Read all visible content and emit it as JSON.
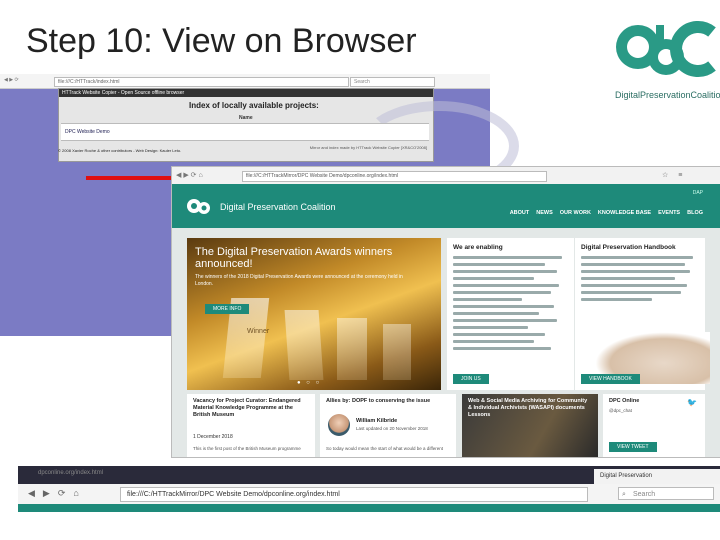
{
  "slide": {
    "title": "Step 10: View on Browser"
  },
  "logo": {
    "caption": "DigitalPreservationCoalition"
  },
  "back_window": {
    "url": "file:///C:/HTTrack/index.html",
    "search_placeholder": "Search",
    "header_bar": "HTTrack Website Copier - Open Source offline browser",
    "index_title": "Index of locally available projects:",
    "row_label": "Name",
    "project_link": "DPC Website Demo",
    "footer_note": "Mirror and index made by HTTrack Website Copier [XR&CO'2008]",
    "bottom_text": "© 2008 Xavier Roche & other contributors - Web Design: Kauler Leto."
  },
  "front_window": {
    "url": "file:///C:/HTTrackMirror/DPC Website Demo/dpconline.org/index.html",
    "brand": "Digital Preservation Coalition",
    "login": "DAP",
    "menu": [
      "ABOUT",
      "NEWS",
      "OUR WORK",
      "KNOWLEDGE BASE",
      "EVENTS",
      "BLOG"
    ],
    "hero": {
      "title": "The Digital Preservation Awards winners announced!",
      "text": "The winners of the 2018 Digital Preservation Awards were announced at the ceremony held in London.",
      "button": "MORE INFO",
      "winner_label": "Winner"
    },
    "cards": {
      "enabling": {
        "title": "We are enabling",
        "button": "JOIN US"
      },
      "handbook": {
        "title": "Digital Preservation Handbook",
        "button": "VIEW HANDBOOK"
      }
    },
    "lower": {
      "card1": {
        "title": "Vacancy for Project Curator: Endangered Material Knowledge Programme at the British Museum",
        "date": "1 December 2018",
        "small": "This is the first post of the British Museum programme"
      },
      "card2": {
        "title": "Allies by: DOPF to conserving the issue",
        "name": "William Kilbride",
        "sub": "Last updated on 20 November 2018",
        "small": "So today would mean the start of what would be a different"
      },
      "card3": {
        "title": "Web & Social Media Archiving for Community & Individual Archivists (WASAPI) documents Lessons"
      },
      "card4": {
        "title": "DPC Online",
        "handle": "@dpc_chat",
        "button": "VIEW TWEET"
      }
    }
  },
  "bottom_browser": {
    "faint_tab": "dpconline.org/index.html",
    "active_tab": "Digital Preservation",
    "url": "file:///C:/HTTrackMirror/DPC Website Demo/dpconline.org/index.html",
    "search_placeholder": "Search"
  },
  "colors": {
    "teal": "#1e8a7a",
    "arrow_red": "#e01010",
    "back_purple": "#7b7bc4"
  }
}
